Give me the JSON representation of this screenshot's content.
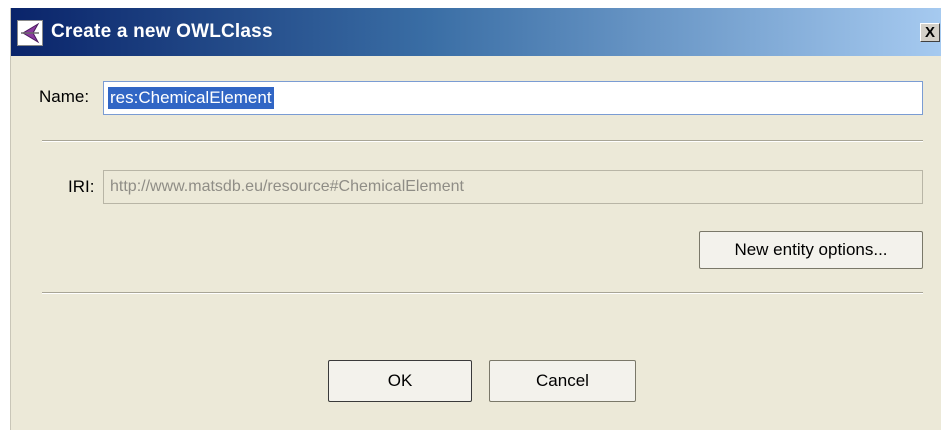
{
  "window": {
    "title": "Create a new OWLClass",
    "app_icon": "protege-icon",
    "close_label": "X"
  },
  "form": {
    "name_label": "Name:",
    "name_value": "res:ChemicalElement",
    "iri_label": "IRI:",
    "iri_value": "http://www.matsdb.eu/resource#ChemicalElement"
  },
  "buttons": {
    "options_label": "New entity options...",
    "ok_label": "OK",
    "cancel_label": "Cancel"
  },
  "colors": {
    "titlebar_start": "#0a246a",
    "titlebar_end": "#a6caf0",
    "selection": "#3166c5",
    "dialog_bg": "#ece9d8"
  }
}
